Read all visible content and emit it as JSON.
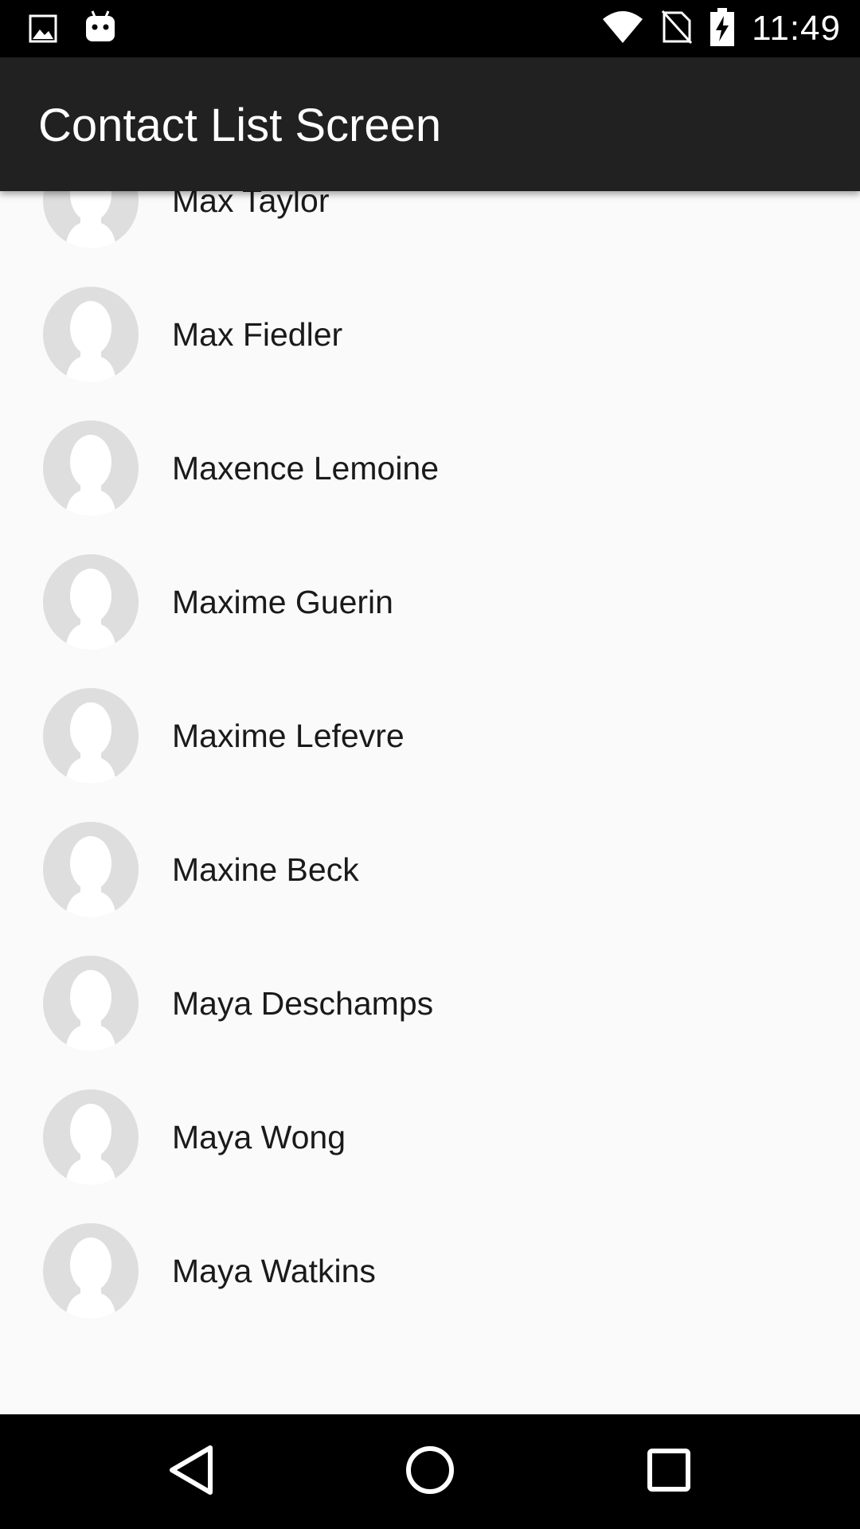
{
  "status_bar": {
    "time": "11:49",
    "icons": [
      "image-notification-icon",
      "android-debug-icon",
      "wifi-icon",
      "no-sim-icon",
      "battery-charging-icon"
    ]
  },
  "app_bar": {
    "title": "Contact List Screen"
  },
  "contacts": [
    {
      "name": "Max Taylor"
    },
    {
      "name": "Max Fiedler"
    },
    {
      "name": "Maxence Lemoine"
    },
    {
      "name": "Maxime Guerin"
    },
    {
      "name": "Maxime Lefevre"
    },
    {
      "name": "Maxine Beck"
    },
    {
      "name": "Maya Deschamps"
    },
    {
      "name": "Maya Wong"
    },
    {
      "name": "Maya Watkins"
    }
  ],
  "nav_bar": {
    "buttons": [
      "back-icon",
      "home-icon",
      "recents-icon"
    ]
  },
  "colors": {
    "status_bar": "#000000",
    "app_bar": "#212121",
    "background": "#fafafa",
    "avatar": "#dedede"
  }
}
